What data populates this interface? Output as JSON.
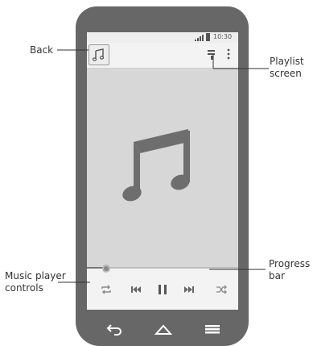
{
  "status_bar": {
    "time": "10:30"
  },
  "callouts": {
    "back": "Back",
    "playlist_line1": "Playlist",
    "playlist_line2": "screen",
    "controls_line1": "Music player",
    "controls_line2": "controls",
    "progress_line1": "Progress",
    "progress_line2": "bar"
  },
  "player": {
    "progress": 0.13
  },
  "icons": {
    "back": "music-note-icon",
    "playlist": "playlist-icon",
    "more": "more-vert-icon",
    "art": "music-note-art-icon",
    "repeat": "repeat-icon",
    "previous": "skip-previous-icon",
    "pause": "pause-icon",
    "next": "skip-next-icon",
    "shuffle": "shuffle-icon",
    "nav_back": "back-icon",
    "home": "home-icon",
    "menu": "menu-icon"
  }
}
